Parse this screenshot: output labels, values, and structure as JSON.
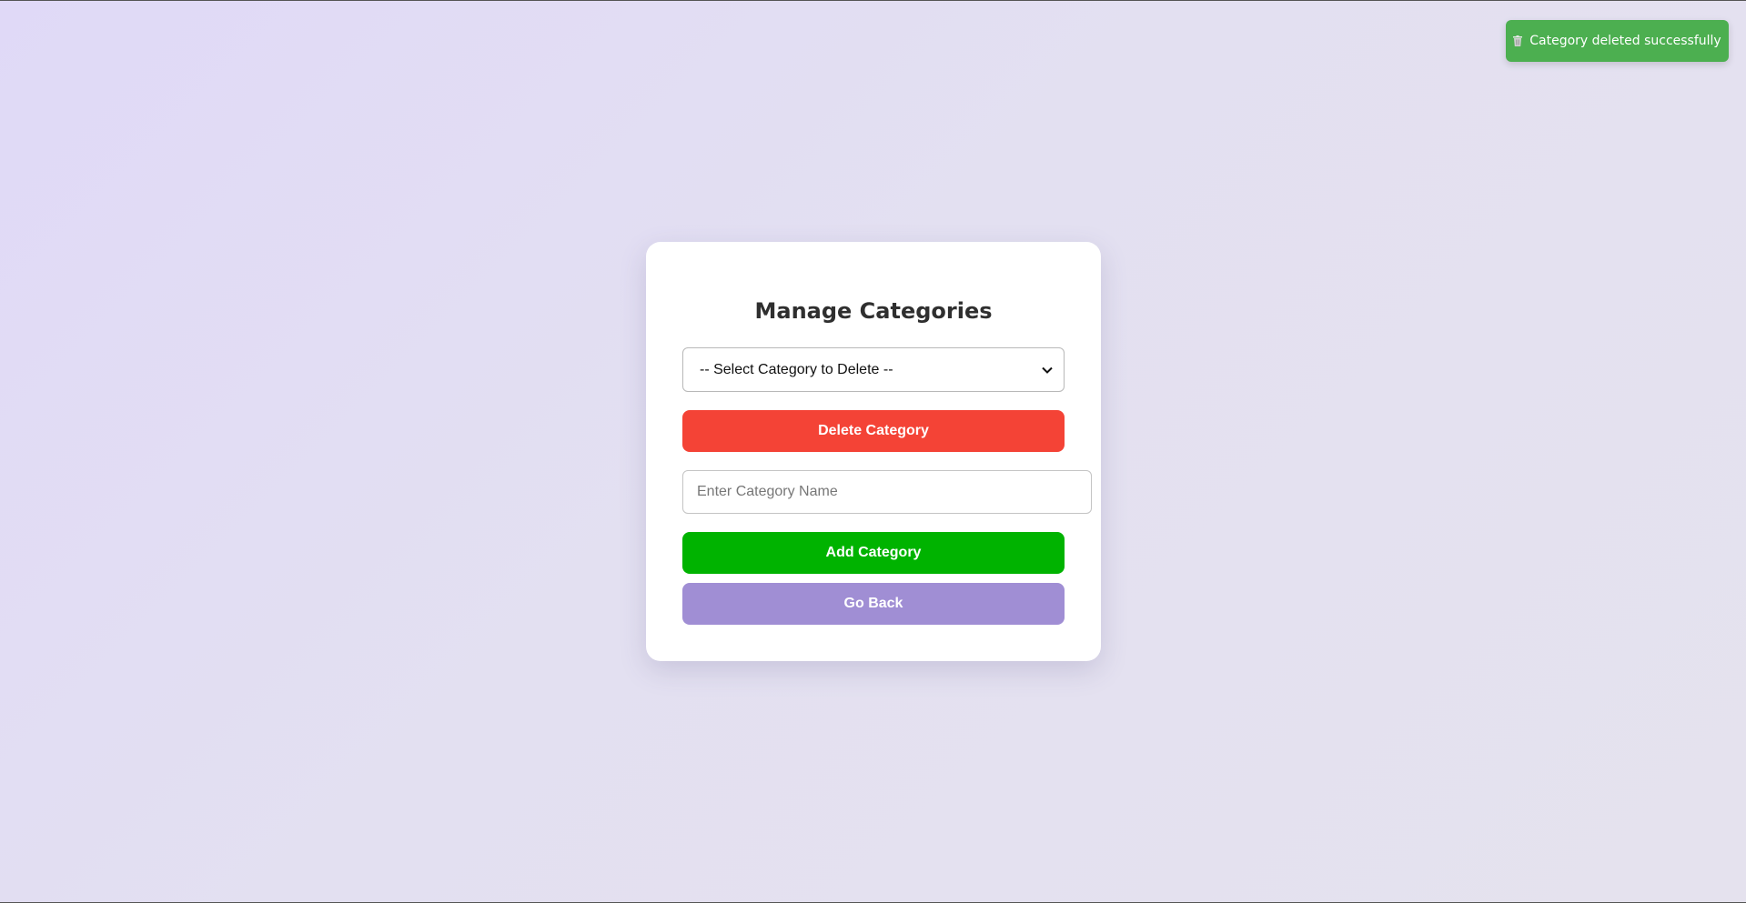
{
  "toast": {
    "icon": "trash-icon",
    "message": "Category deleted successfully",
    "color": "#4caf50"
  },
  "card": {
    "title": "Manage Categories",
    "select": {
      "selected": "-- Select Category to Delete --"
    },
    "delete_button": {
      "label": "Delete Category",
      "color": "#f44336"
    },
    "name_input": {
      "value": "",
      "placeholder": "Enter Category Name"
    },
    "add_button": {
      "label": "Add Category",
      "color": "#00b300"
    },
    "back_button": {
      "label": "Go Back",
      "color": "#a08ed4"
    }
  }
}
